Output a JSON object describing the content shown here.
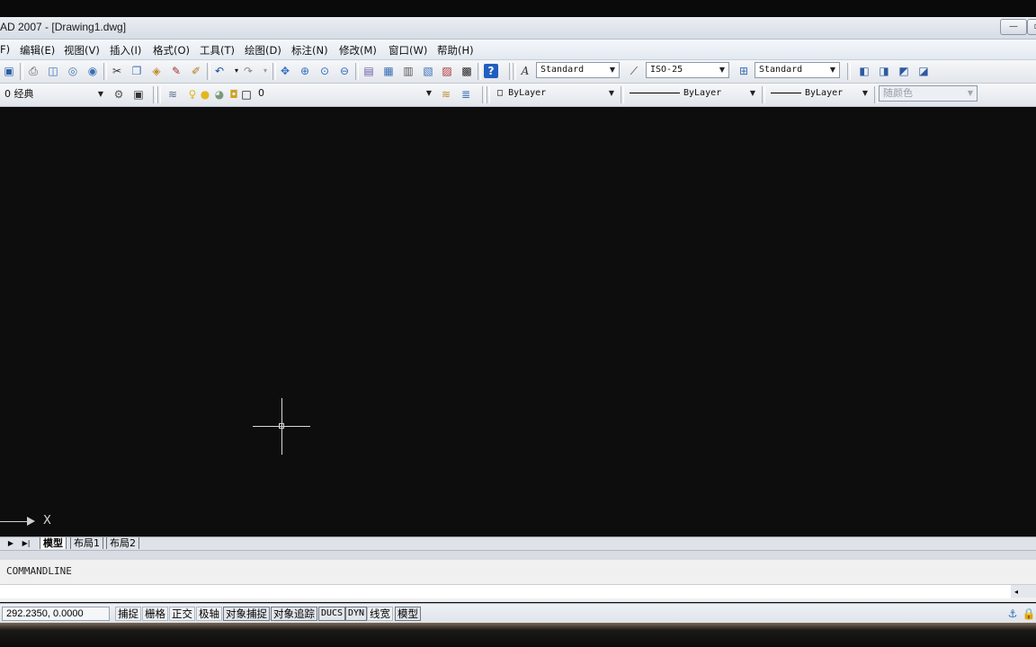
{
  "window": {
    "title": "AD 2007 - [Drawing1.dwg]",
    "minimize": "—",
    "restore": "▫"
  },
  "menubar": {
    "items": [
      "F)",
      "编辑(E)",
      "视图(V)",
      "插入(I)",
      "格式(O)",
      "工具(T)",
      "绘图(D)",
      "标注(N)",
      "修改(M)",
      "窗口(W)",
      "帮助(H)"
    ]
  },
  "toolbar1": {
    "text_style": "Standard",
    "dim_style": "ISO-25",
    "table_style": "Standard"
  },
  "toolbar2": {
    "workspace": "0 经典",
    "layer": "0",
    "color": "ByLayer",
    "linetype": "ByLayer",
    "lineweight": "ByLayer",
    "plotstyle": "随颜色"
  },
  "drawing": {
    "ucs_axis_label": "X"
  },
  "tabs": {
    "model": "模型",
    "layout1": "布局1",
    "layout2": "布局2"
  },
  "command": {
    "text": "COMMANDLINE",
    "scroll_arrow": "◂"
  },
  "status": {
    "coordinates": "292.2350,  0.0000",
    "buttons": [
      "捕捉",
      "栅格",
      "正交",
      "极轴",
      "对象捕捉",
      "对象追踪",
      "DUCS",
      "DYN",
      "线宽",
      "模型"
    ]
  },
  "colors": {
    "canvas": "#0d0d0d",
    "crosshair": "#d8d8d8",
    "help_icon": "#1f5fbf"
  }
}
